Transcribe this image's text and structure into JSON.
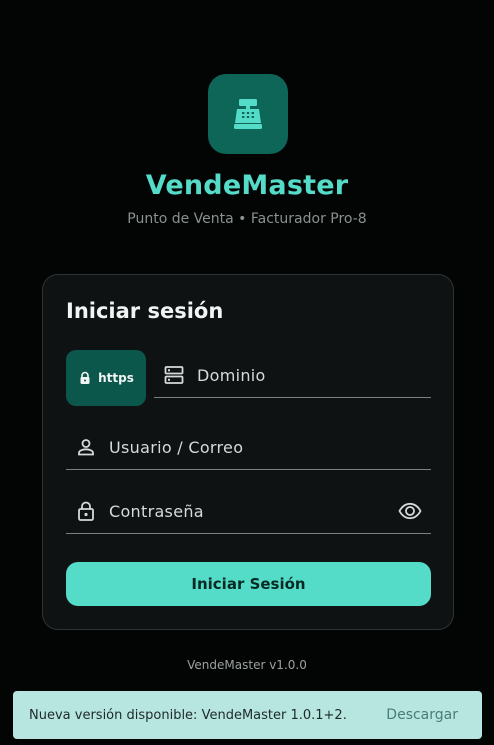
{
  "app": {
    "name": "VendeMaster",
    "subtitle": "Punto de Venta • Facturador Pro-8",
    "brand_color": "#55dcc8",
    "logo_icon": "cash-register-icon"
  },
  "login": {
    "title": "Iniciar sesión",
    "protocol_chip": "https",
    "domain_placeholder": "Dominio",
    "user_placeholder": "Usuario / Correo",
    "password_placeholder": "Contraseña",
    "submit_label": "Iniciar Sesión"
  },
  "footer": {
    "version": "VendeMaster v1.0.0"
  },
  "snackbar": {
    "message": "Nueva versión disponible: VendeMaster 1.0.1+2.",
    "action": "Descargar"
  }
}
